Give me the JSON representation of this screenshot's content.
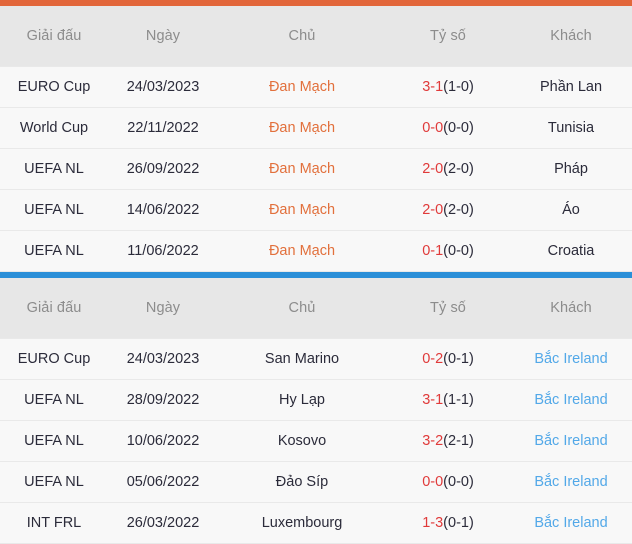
{
  "columns": {
    "league": "Giải đấu",
    "date": "Ngày",
    "home": "Chủ",
    "score": "Tỷ số",
    "away": "Khách"
  },
  "colors": {
    "accent_orange": "#e2663a",
    "accent_blue": "#2b8fd8",
    "score_main": "#e03a3a",
    "score_half": "#2b2b3a",
    "team_orange": "#e2703c",
    "team_blue": "#52a8e8",
    "header_bg": "#e7e7e7",
    "row_bg": "#f8f8f8",
    "header_text": "#8c8c8c",
    "row_text": "#2b2b3a"
  },
  "blocks": [
    {
      "accent": "#e2663a",
      "focus_team": "Đan Mạch",
      "focus_side": "home",
      "focus_color": "orange",
      "rows": [
        {
          "league": "EURO Cup",
          "date": "24/03/2023",
          "home": "Đan Mạch",
          "score_main": "3-1",
          "score_half": "(1-0)",
          "away": "Phần Lan"
        },
        {
          "league": "World Cup",
          "date": "22/11/2022",
          "home": "Đan Mạch",
          "score_main": "0-0",
          "score_half": "(0-0)",
          "away": "Tunisia"
        },
        {
          "league": "UEFA NL",
          "date": "26/09/2022",
          "home": "Đan Mạch",
          "score_main": "2-0",
          "score_half": "(2-0)",
          "away": "Pháp"
        },
        {
          "league": "UEFA NL",
          "date": "14/06/2022",
          "home": "Đan Mạch",
          "score_main": "2-0",
          "score_half": "(2-0)",
          "away": "Áo"
        },
        {
          "league": "UEFA NL",
          "date": "11/06/2022",
          "home": "Đan Mạch",
          "score_main": "0-1",
          "score_half": "(0-0)",
          "away": "Croatia"
        }
      ]
    },
    {
      "accent": "#2b8fd8",
      "focus_team": "Bắc Ireland",
      "focus_side": "away",
      "focus_color": "blue",
      "rows": [
        {
          "league": "EURO Cup",
          "date": "24/03/2023",
          "home": "San Marino",
          "score_main": "0-2",
          "score_half": "(0-1)",
          "away": "Bắc Ireland"
        },
        {
          "league": "UEFA NL",
          "date": "28/09/2022",
          "home": "Hy Lạp",
          "score_main": "3-1",
          "score_half": "(1-1)",
          "away": "Bắc Ireland"
        },
        {
          "league": "UEFA NL",
          "date": "10/06/2022",
          "home": "Kosovo",
          "score_main": "3-2",
          "score_half": "(2-1)",
          "away": "Bắc Ireland"
        },
        {
          "league": "UEFA NL",
          "date": "05/06/2022",
          "home": "Đảo Síp",
          "score_main": "0-0",
          "score_half": "(0-0)",
          "away": "Bắc Ireland"
        },
        {
          "league": "INT FRL",
          "date": "26/03/2022",
          "home": "Luxembourg",
          "score_main": "1-3",
          "score_half": "(0-1)",
          "away": "Bắc Ireland"
        }
      ]
    }
  ]
}
